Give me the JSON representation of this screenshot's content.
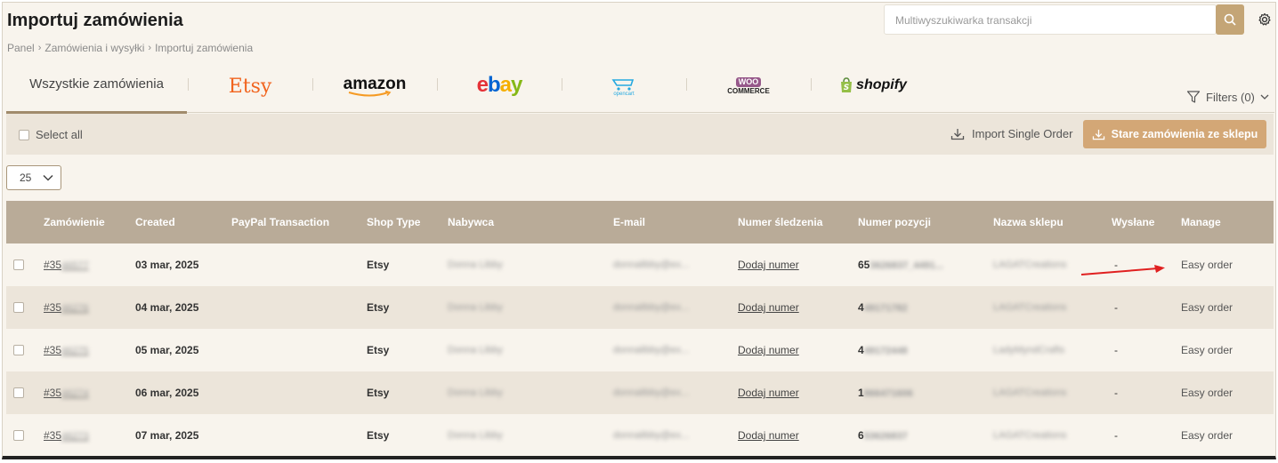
{
  "header": {
    "title": "Importuj zamówienia",
    "breadcrumb": [
      "Panel",
      "Zamówienia i wysyłki",
      "Importuj zamówienia"
    ],
    "breadcrumb_sep": "›",
    "search_placeholder": "Multiwyszukiwarka transakcji"
  },
  "tabs": {
    "all_label": "Wszystkie zamówienia",
    "etsy": "Etsy",
    "amazon": "amazon",
    "ebay": [
      "e",
      "b",
      "a",
      "y"
    ],
    "opencart": "opencart",
    "woo": [
      "WOO",
      "COMMERCE"
    ],
    "shopify": "shopify"
  },
  "filters_label": "Filters (0)",
  "toolbar": {
    "select_all": "Select all",
    "import_single": "Import Single Order",
    "stare_button": "Stare zamówienia ze sklepu"
  },
  "pager": {
    "page_size": "25"
  },
  "table": {
    "headers": [
      "Zamówienie",
      "Created",
      "PayPal Transaction",
      "Shop Type",
      "Nabywca",
      "E-mail",
      "Numer śledzenia",
      "Numer pozycji",
      "Nazwa sklepu",
      "Wysłane",
      "Manage"
    ],
    "rows": [
      {
        "order": "#35",
        "order_blur": "46577",
        "created": "03 mar, 2025",
        "paypal": "",
        "shop": "Etsy",
        "buyer": "Donna Libby",
        "email": "donnalibby@ex...",
        "tracking": "Dodaj numer",
        "pos": "65",
        "pos_blur": "3626837_4491...",
        "store": "LAGATCreations",
        "sent": "-",
        "manage": "Easy order"
      },
      {
        "order": "#35",
        "order_blur": "46276",
        "created": "04 mar, 2025",
        "paypal": "",
        "shop": "Etsy",
        "buyer": "Donna Libby",
        "email": "donnalibby@ex...",
        "tracking": "Dodaj numer",
        "pos": "4",
        "pos_blur": "49171782",
        "store": "LAGATCreations",
        "sent": "-",
        "manage": "Easy order"
      },
      {
        "order": "#35",
        "order_blur": "46275",
        "created": "05 mar, 2025",
        "paypal": "",
        "shop": "Etsy",
        "buyer": "Donna Libby",
        "email": "donnalibby@ex...",
        "tracking": "Dodaj numer",
        "pos": "4",
        "pos_blur": "49172448",
        "store": "LadyMyndCrafts",
        "sent": "-",
        "manage": "Easy order"
      },
      {
        "order": "#35",
        "order_blur": "46274",
        "created": "06 mar, 2025",
        "paypal": "",
        "shop": "Etsy",
        "buyer": "Donna Libby",
        "email": "donnalibby@ex...",
        "tracking": "Dodaj numer",
        "pos": "1",
        "pos_blur": "866471606",
        "store": "LAGATCreations",
        "sent": "-",
        "manage": "Easy order"
      },
      {
        "order": "#35",
        "order_blur": "46273",
        "created": "07 mar, 2025",
        "paypal": "",
        "shop": "Etsy",
        "buyer": "Donna Libby",
        "email": "donnalibby@ex...",
        "tracking": "Dodaj numer",
        "pos": "6",
        "pos_blur": "53626837",
        "store": "LAGATCreations",
        "sent": "-",
        "manage": "Easy order"
      }
    ]
  },
  "colors": {
    "accent": "#d3a776",
    "header_row": "#b9ab98",
    "arrow": "#e02020"
  }
}
